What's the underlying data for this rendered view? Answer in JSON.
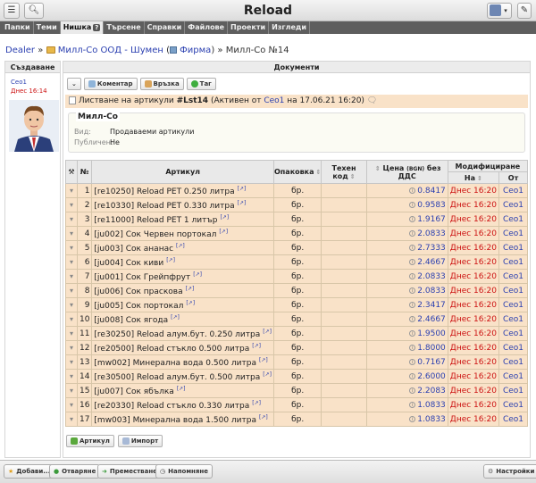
{
  "app": {
    "title": "Reload",
    "user_name": "Ceo1"
  },
  "menu": [
    {
      "label": "Папки",
      "active": false
    },
    {
      "label": "Теми",
      "active": false
    },
    {
      "label": "Нишка",
      "active": true
    },
    {
      "label": "Търсене",
      "active": false
    },
    {
      "label": "Справки",
      "active": false
    },
    {
      "label": "Файлове",
      "active": false
    },
    {
      "label": "Проекти",
      "active": false
    },
    {
      "label": "Изгледи",
      "active": false
    }
  ],
  "breadcrumb": {
    "root": "Dealer",
    "sep1": "»",
    "company": "Милл-Со ООД - Шумен",
    "company_type": "Фирма",
    "sep2": "»",
    "current": "Милл-Со №14"
  },
  "left": {
    "header": "Създаване",
    "user": "Ceo1",
    "date": "Днес 16:14"
  },
  "main": {
    "header": "Документи",
    "actions": {
      "comment": "Коментар",
      "link": "Връзка",
      "tag": "Таг"
    },
    "listing": {
      "prefix": "Листване на артикули",
      "id": "#Lst14",
      "status_pre": "(Активен от",
      "status_by": "Ceo1",
      "status_post": "на 17.06.21 16:20)"
    },
    "info": {
      "title": "Милл-Со",
      "type_label": "Вид:",
      "type_value": "Продаваеми артикули",
      "public_label": "Публичен:",
      "public_value": "Не"
    },
    "table": {
      "headers": {
        "tools": "⚒",
        "no": "№",
        "article": "Артикул",
        "pack": "Опаковка",
        "tech": "Техен код",
        "price_pre": "Цена",
        "price_cur": "(BGN)",
        "price_post": "без ДДС",
        "modified": "Модифициране",
        "on": "На",
        "by": "От"
      },
      "rows": [
        {
          "n": "1",
          "article": "[re10250] Reload PET 0.250 литра",
          "pack": "бр.",
          "price": "0.8417",
          "date": "Днес 16:20",
          "by": "Ceo1"
        },
        {
          "n": "2",
          "article": "[re10330] Reload PET 0.330 литра",
          "pack": "бр.",
          "price": "0.9583",
          "date": "Днес 16:20",
          "by": "Ceo1"
        },
        {
          "n": "3",
          "article": "[re11000] Reload PET 1 литър",
          "pack": "бр.",
          "price": "1.9167",
          "date": "Днес 16:20",
          "by": "Ceo1"
        },
        {
          "n": "4",
          "article": "[ju002] Сок Червен портокал",
          "pack": "бр.",
          "price": "2.0833",
          "date": "Днес 16:20",
          "by": "Ceo1"
        },
        {
          "n": "5",
          "article": "[ju003] Сок ананас",
          "pack": "бр.",
          "price": "2.7333",
          "date": "Днес 16:20",
          "by": "Ceo1"
        },
        {
          "n": "6",
          "article": "[ju004] Сок киви",
          "pack": "бр.",
          "price": "2.4667",
          "date": "Днес 16:20",
          "by": "Ceo1"
        },
        {
          "n": "7",
          "article": "[ju001] Сок Грейпфрут",
          "pack": "бр.",
          "price": "2.0833",
          "date": "Днес 16:20",
          "by": "Ceo1"
        },
        {
          "n": "8",
          "article": "[ju006] Сок праскова",
          "pack": "бр.",
          "price": "2.0833",
          "date": "Днес 16:20",
          "by": "Ceo1"
        },
        {
          "n": "9",
          "article": "[ju005] Сок портокал",
          "pack": "бр.",
          "price": "2.3417",
          "date": "Днес 16:20",
          "by": "Ceo1"
        },
        {
          "n": "10",
          "article": "[ju008] Сок ягода",
          "pack": "бр.",
          "price": "2.4667",
          "date": "Днес 16:20",
          "by": "Ceo1"
        },
        {
          "n": "11",
          "article": "[re30250] Reload алум.бут. 0.250 литра",
          "pack": "бр.",
          "price": "1.9500",
          "date": "Днес 16:20",
          "by": "Ceo1"
        },
        {
          "n": "12",
          "article": "[re20500] Reload стъкло 0.500 литра",
          "pack": "бр.",
          "price": "1.8000",
          "date": "Днес 16:20",
          "by": "Ceo1"
        },
        {
          "n": "13",
          "article": "[mw002] Минерална вода 0.500 литра",
          "pack": "бр.",
          "price": "0.7167",
          "date": "Днес 16:20",
          "by": "Ceo1"
        },
        {
          "n": "14",
          "article": "[re30500] Reload алум.бут. 0.500 литра",
          "pack": "бр.",
          "price": "2.6000",
          "date": "Днес 16:20",
          "by": "Ceo1"
        },
        {
          "n": "15",
          "article": "[ju007] Сок ябълка",
          "pack": "бр.",
          "price": "2.2083",
          "date": "Днес 16:20",
          "by": "Ceo1"
        },
        {
          "n": "16",
          "article": "[re20330] Reload стъкло 0.330 литра",
          "pack": "бр.",
          "price": "1.0833",
          "date": "Днес 16:20",
          "by": "Ceo1"
        },
        {
          "n": "17",
          "article": "[mw003] Минерална вода 1.500 литра",
          "pack": "бр.",
          "price": "1.0833",
          "date": "Днес 16:20",
          "by": "Ceo1"
        }
      ]
    },
    "bottom_actions": {
      "article": "Артикул",
      "import": "Импорт"
    }
  },
  "footer": {
    "add": "Добави...",
    "open": "Отваряне",
    "move": "Преместване",
    "remind": "Напомняне",
    "settings": "Настройки"
  }
}
